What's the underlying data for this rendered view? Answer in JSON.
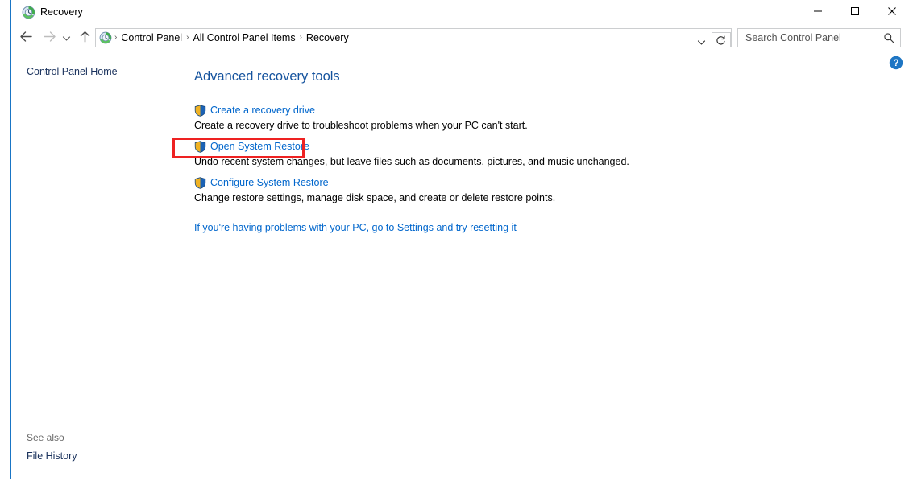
{
  "window": {
    "title": "Recovery",
    "icon": "recovery-icon",
    "controls": {
      "minimize": "minimize-icon",
      "maximize": "maximize-icon",
      "close": "close-icon"
    }
  },
  "navbar": {
    "back": "back-arrow-icon",
    "forward": "forward-arrow-icon",
    "recent": "recent-locations-chevron-icon",
    "up": "up-arrow-icon",
    "address_icon": "recovery-icon",
    "breadcrumbs": [
      {
        "label": "Control Panel"
      },
      {
        "label": "All Control Panel Items"
      },
      {
        "label": "Recovery"
      }
    ],
    "separator": "›",
    "dropdown": "chevron-down-icon",
    "refresh": "refresh-icon"
  },
  "search": {
    "placeholder": "Search Control Panel",
    "value": "",
    "icon": "search-icon"
  },
  "sidebar": {
    "home_label": "Control Panel Home",
    "see_also_label": "See also",
    "see_also_items": [
      {
        "label": "File History"
      }
    ]
  },
  "main": {
    "help": "help-icon",
    "heading": "Advanced recovery tools",
    "tools": [
      {
        "icon": "uac-shield-icon",
        "link": "Create a recovery drive",
        "description": "Create a recovery drive to troubleshoot problems when your PC can't start."
      },
      {
        "icon": "uac-shield-icon",
        "link": "Open System Restore",
        "description": "Undo recent system changes, but leave files such as documents, pictures, and music unchanged."
      },
      {
        "icon": "uac-shield-icon",
        "link": "Configure System Restore",
        "description": "Change restore settings, manage disk space, and create or delete restore points."
      }
    ],
    "settings_link": "If you're having problems with your PC, go to Settings and try resetting it"
  },
  "annotation": {
    "color": "#ee2222",
    "target": "Open System Restore"
  }
}
